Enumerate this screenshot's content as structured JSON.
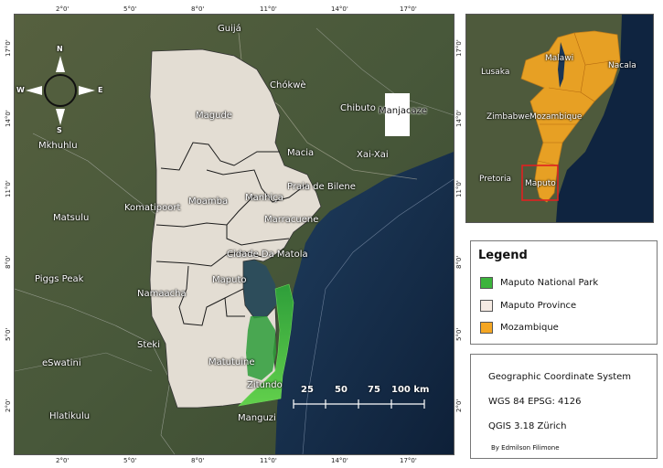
{
  "main_map": {
    "lon_ticks": [
      "2°0'",
      "5°0'",
      "8°0'",
      "11°0'",
      "14°0'",
      "17°0'"
    ],
    "lat_ticks": [
      "17°0'",
      "14°0'",
      "11°0'",
      "8°0'",
      "5°0'",
      "2°0'"
    ],
    "places": {
      "guija": "Guijá",
      "chokwe": "Chókwè",
      "chibuto": "Chibuto",
      "manjacaze": "Manjacaze",
      "magude": "Magude",
      "macia": "Macia",
      "xai_xai": "Xai-Xai",
      "mkhuhlu": "Mkhuhlu",
      "praia": "Praia de Bilene",
      "moamba": "Moamba",
      "manhica": "Manhiça",
      "komatipoort": "Komatipoort",
      "matsulu": "Matsulu",
      "marracuene": "Marracuene",
      "matola": "Cidade Da Matola",
      "piggs_peak": "Piggs Peak",
      "maputo": "Maputo",
      "namaacha": "Namaacha",
      "steki": "Steki",
      "eswatini": "eSwatini",
      "matutuine": "Matutuine",
      "zitundo": "Zitundo",
      "hlatikulu": "Hlatikulu",
      "manguzi": "Manguzi"
    },
    "compass": {
      "n": "N",
      "s": "S",
      "e": "E",
      "w": "W"
    },
    "scale_labels": [
      "25",
      "50",
      "75",
      "100 km"
    ]
  },
  "inset_map": {
    "places": {
      "malawi": "Malawi",
      "lusaka": "Lusaka",
      "nacala": "Nacala",
      "zimbabwe": "Zimbabwe",
      "mozambique": "Mozambique",
      "pretoria": "Pretoria",
      "maputo": "Maputo"
    }
  },
  "legend": {
    "title": "Legend",
    "items": [
      {
        "label": "Maputo National Park",
        "color": "#3cb43c"
      },
      {
        "label": "Maputo Province",
        "color": "#f6ebe3"
      },
      {
        "label": "Mozambique",
        "color": "#f4a623"
      }
    ]
  },
  "info": {
    "line1": "Geographic Coordinate System",
    "line2": "WGS 84 EPSG: 4126",
    "line3": "QGIS 3.18 Zürich",
    "author": "By Edmilson Filimone"
  },
  "colors": {
    "land": "#4a5a3a",
    "ocean": "#1a3150",
    "province": "#e2dcd2",
    "park": "#3cb43c",
    "inset_highlight": "#e02020"
  }
}
